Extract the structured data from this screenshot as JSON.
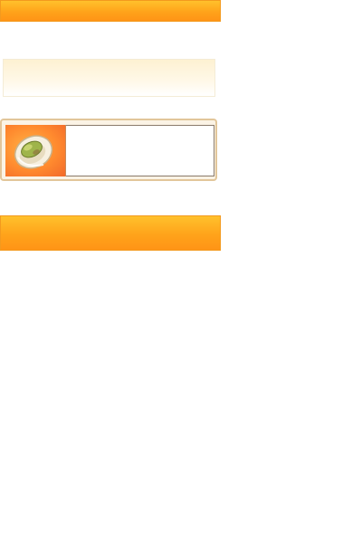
{
  "header": {
    "title": ""
  },
  "notice": {
    "text": ""
  },
  "product": {
    "image_icon": "pistachio-icon",
    "info_text": ""
  },
  "footer": {
    "label": ""
  },
  "colors": {
    "accent_orange": "#ffa31a",
    "card_border": "#e2c69a",
    "notice_bg": "#fdf1d2"
  }
}
